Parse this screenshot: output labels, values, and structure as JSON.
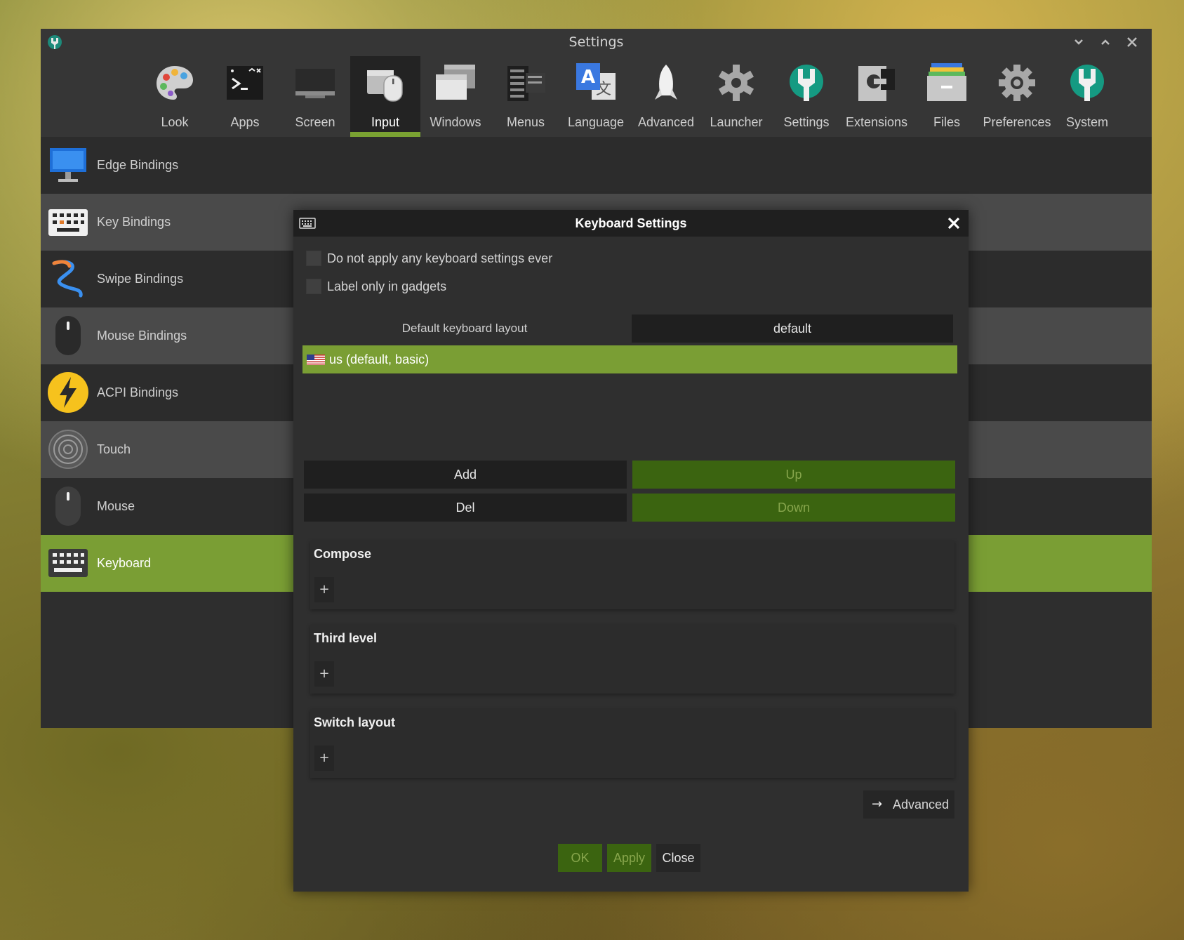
{
  "window": {
    "title": "Settings"
  },
  "toolbar": {
    "items": [
      {
        "label": "Look",
        "icon": "palette-icon"
      },
      {
        "label": "Apps",
        "icon": "terminal-icon"
      },
      {
        "label": "Screen",
        "icon": "screen-icon"
      },
      {
        "label": "Input",
        "icon": "mouse-keyboard-icon",
        "active": true
      },
      {
        "label": "Windows",
        "icon": "windows-icon"
      },
      {
        "label": "Menus",
        "icon": "menus-icon"
      },
      {
        "label": "Language",
        "icon": "translate-icon"
      },
      {
        "label": "Advanced",
        "icon": "rocket-icon"
      },
      {
        "label": "Launcher",
        "icon": "launcher-gear-icon"
      },
      {
        "label": "Settings",
        "icon": "settings-wrench-icon"
      },
      {
        "label": "Extensions",
        "icon": "extensions-icon"
      },
      {
        "label": "Files",
        "icon": "files-icon"
      },
      {
        "label": "Preferences",
        "icon": "preferences-gear-icon"
      },
      {
        "label": "System",
        "icon": "system-wrench-icon"
      }
    ]
  },
  "sidebar": {
    "items": [
      {
        "label": "Edge Bindings",
        "icon": "monitor-icon"
      },
      {
        "label": "Key Bindings",
        "icon": "keyboard-icon"
      },
      {
        "label": "Swipe Bindings",
        "icon": "swipe-icon"
      },
      {
        "label": "Mouse Bindings",
        "icon": "mouse-icon"
      },
      {
        "label": "ACPI Bindings",
        "icon": "lightning-icon"
      },
      {
        "label": "Touch",
        "icon": "touch-icon"
      },
      {
        "label": "Mouse",
        "icon": "mouse-icon"
      },
      {
        "label": "Keyboard",
        "icon": "keyboard-icon",
        "selected": true
      }
    ]
  },
  "dialog": {
    "title": "Keyboard Settings",
    "checkboxes": [
      {
        "label": "Do not apply any keyboard settings ever",
        "checked": false
      },
      {
        "label": "Label only in gadgets",
        "checked": false
      }
    ],
    "default_layout_label": "Default keyboard layout",
    "default_layout_value": "default",
    "layouts": [
      {
        "label": "us (default, basic)",
        "flag": "us-flag-icon"
      }
    ],
    "buttons": {
      "add": "Add",
      "del": "Del",
      "up": "Up",
      "down": "Down"
    },
    "sections": [
      {
        "title": "Compose",
        "plus": "+"
      },
      {
        "title": "Third level",
        "plus": "+"
      },
      {
        "title": "Switch layout",
        "plus": "+"
      }
    ],
    "advanced": {
      "arrow": "→",
      "label": "Advanced"
    },
    "footer": {
      "ok": "OK",
      "apply": "Apply",
      "close": "Close"
    }
  },
  "colors": {
    "accent": "#7a9e34",
    "accent_dark": "#3b6410",
    "window_bg": "#2e2e2e",
    "titlebar_bg": "#1f1f1f"
  }
}
